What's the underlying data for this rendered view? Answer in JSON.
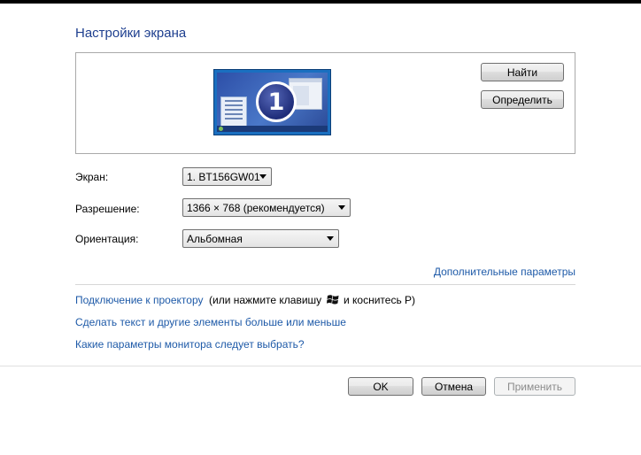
{
  "page_title": "Настройки экрана",
  "preview": {
    "monitor_number": "1",
    "find_button": "Найти",
    "identify_button": "Определить"
  },
  "display": {
    "label": "Экран:",
    "value": "1. BT156GW01"
  },
  "resolution": {
    "label": "Разрешение:",
    "value": "1366 × 768 (рекомендуется)"
  },
  "orientation": {
    "label": "Ориентация:",
    "value": "Альбомная"
  },
  "advanced_link": "Дополнительные параметры",
  "links": {
    "projector": "Подключение к проектору",
    "projector_hint_before": "(или нажмите клавишу",
    "projector_hint_after": "и коснитесь Р)",
    "text_size": "Сделать текст и другие элементы больше или меньше",
    "monitor_help": "Какие параметры монитора следует выбрать?"
  },
  "footer": {
    "ok": "OK",
    "cancel": "Отмена",
    "apply": "Применить"
  },
  "colors": {
    "title": "#1e3f8f",
    "link": "#1e5aa8"
  }
}
